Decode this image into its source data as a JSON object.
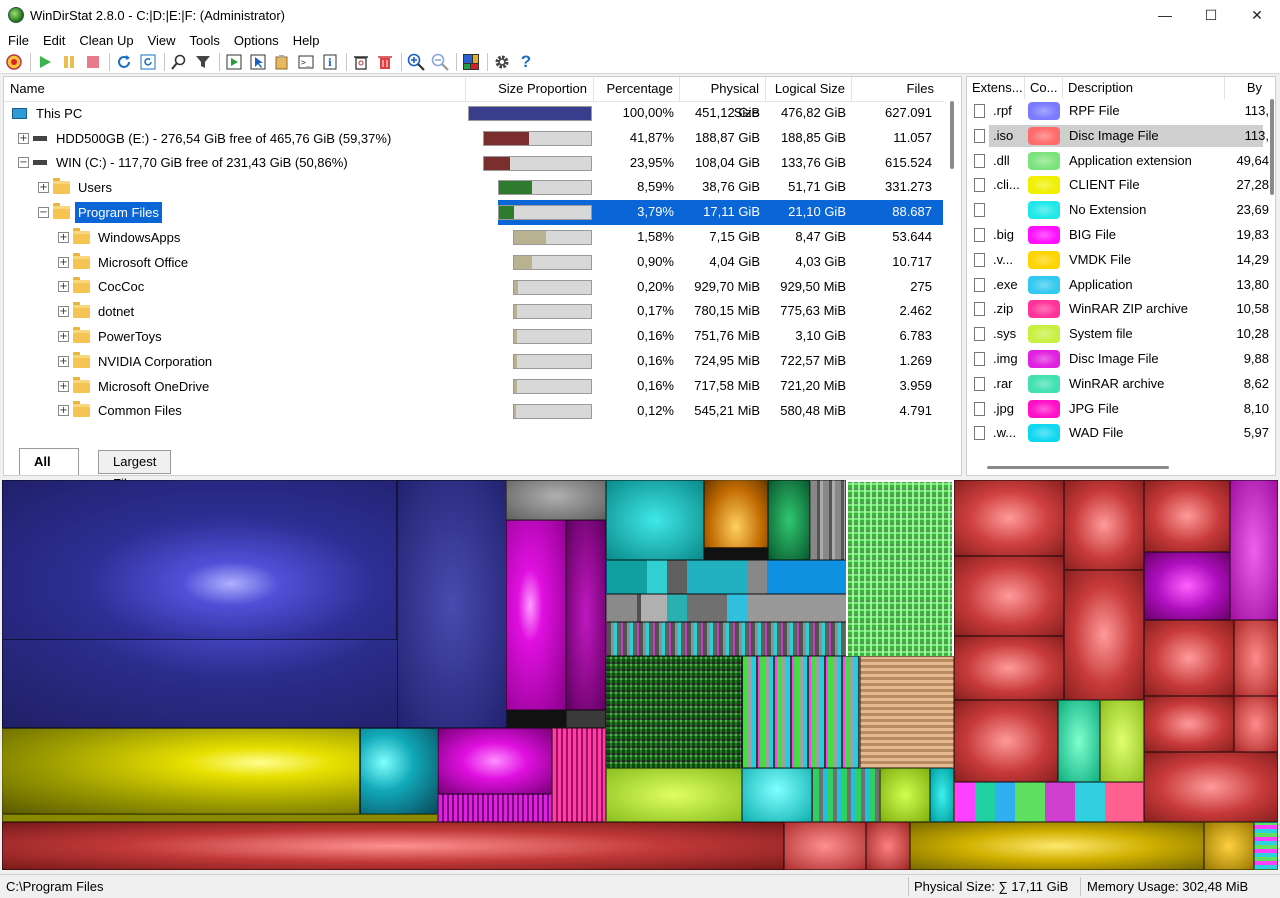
{
  "window": {
    "title": "WinDirStat 2.8.0 - C:|D:|E:|F:  (Administrator)",
    "min_glyph": "—",
    "max_glyph": "☐",
    "close_glyph": "✕"
  },
  "menu": [
    "File",
    "Edit",
    "Clean Up",
    "View",
    "Tools",
    "Options",
    "Help"
  ],
  "toolbar_icons": [
    "record-icon",
    "play-icon",
    "pause-icon",
    "stop-icon",
    "refresh-icon",
    "refresh-all-icon",
    "search-icon",
    "filter-icon",
    "open-item-icon",
    "select-in-explorer-icon",
    "copy-path-icon",
    "command-prompt-icon",
    "properties-icon",
    "recycle-icon",
    "delete-icon",
    "zoom-in-icon",
    "zoom-out-icon",
    "treemap-toggle-icon",
    "settings-icon",
    "help-icon"
  ],
  "tree": {
    "columns": {
      "name": "Name",
      "size_proportion": "Size Proportion",
      "percentage": "Percentage",
      "physical": "Physical Size",
      "logical": "Logical Size",
      "files": "Files"
    },
    "rows": [
      {
        "name": "This PC",
        "indent": 0,
        "icon": "pc",
        "expander": "",
        "bar_fill": 1.0,
        "bar_color": "#3a3d8c",
        "pct": "100,00%",
        "phys": "451,12 GiB",
        "log": "476,82 GiB",
        "files": "627.091"
      },
      {
        "name": "HDD500GB (E:) - 276,54 GiB free of 465,76 GiB (59,37%)",
        "indent": 1,
        "icon": "drive",
        "expander": "+",
        "bar_fill": 0.4187,
        "bar_color": "#7a2e2e",
        "pct": "41,87%",
        "phys": "188,87 GiB",
        "log": "188,85 GiB",
        "files": "11.057"
      },
      {
        "name": "WIN (C:) - 117,70 GiB free of 231,43 GiB (50,86%)",
        "indent": 1,
        "icon": "drive",
        "expander": "-",
        "bar_fill": 0.2395,
        "bar_color": "#7a2e2e",
        "pct": "23,95%",
        "phys": "108,04 GiB",
        "log": "133,76 GiB",
        "files": "615.524"
      },
      {
        "name": "Users",
        "indent": 2,
        "icon": "folder",
        "expander": "+",
        "bar_fill": 0.359,
        "bar_color": "#2e7a2e",
        "pct": "8,59%",
        "phys": "38,76 GiB",
        "log": "51,71 GiB",
        "files": "331.273"
      },
      {
        "name": "Program Files",
        "indent": 2,
        "icon": "folder",
        "expander": "-",
        "bar_fill": 0.158,
        "bar_color": "#2e7a2e",
        "pct": "3,79%",
        "phys": "17,11 GiB",
        "log": "21,10 GiB",
        "files": "88.687",
        "selected": true
      },
      {
        "name": "WindowsApps",
        "indent": 3,
        "icon": "folder",
        "expander": "+",
        "bar_fill": 0.417,
        "bar_color": "#b8b291",
        "pct": "1,58%",
        "phys": "7,15 GiB",
        "log": "8,47 GiB",
        "files": "53.644"
      },
      {
        "name": "Microsoft Office",
        "indent": 3,
        "icon": "folder",
        "expander": "+",
        "bar_fill": 0.237,
        "bar_color": "#b8b291",
        "pct": "0,90%",
        "phys": "4,04 GiB",
        "log": "4,03 GiB",
        "files": "10.717"
      },
      {
        "name": "CocCoc",
        "indent": 3,
        "icon": "folder",
        "expander": "+",
        "bar_fill": 0.053,
        "bar_color": "#b8b291",
        "pct": "0,20%",
        "phys": "929,70 MiB",
        "log": "929,50 MiB",
        "files": "275"
      },
      {
        "name": "dotnet",
        "indent": 3,
        "icon": "folder",
        "expander": "+",
        "bar_fill": 0.045,
        "bar_color": "#b8b291",
        "pct": "0,17%",
        "phys": "780,15 MiB",
        "log": "775,63 MiB",
        "files": "2.462"
      },
      {
        "name": "PowerToys",
        "indent": 3,
        "icon": "folder",
        "expander": "+",
        "bar_fill": 0.042,
        "bar_color": "#b8b291",
        "pct": "0,16%",
        "phys": "751,76 MiB",
        "log": "3,10 GiB",
        "files": "6.783"
      },
      {
        "name": "NVIDIA Corporation",
        "indent": 3,
        "icon": "folder",
        "expander": "+",
        "bar_fill": 0.042,
        "bar_color": "#b8b291",
        "pct": "0,16%",
        "phys": "724,95 MiB",
        "log": "722,57 MiB",
        "files": "1.269"
      },
      {
        "name": "Microsoft OneDrive",
        "indent": 3,
        "icon": "folder",
        "expander": "+",
        "bar_fill": 0.042,
        "bar_color": "#b8b291",
        "pct": "0,16%",
        "phys": "717,58 MiB",
        "log": "721,20 MiB",
        "files": "3.959"
      },
      {
        "name": "Common Files",
        "indent": 3,
        "icon": "folder",
        "expander": "+",
        "bar_fill": 0.032,
        "bar_color": "#b8b291",
        "pct": "0,12%",
        "phys": "545,21 MiB",
        "log": "580,48 MiB",
        "files": "4.791"
      }
    ],
    "tabs": {
      "all": "All Files",
      "largest": "Largest Files"
    }
  },
  "extensions": {
    "columns": {
      "ext": "Extens...",
      "color": "Co...",
      "desc": "Description",
      "bytes": "By"
    },
    "rows": [
      {
        "ext": ".rpf",
        "color": "#7b7bff",
        "desc": "RPF File",
        "bytes": "113,"
      },
      {
        "ext": ".iso",
        "color": "#ff6b6b",
        "desc": "Disc Image File",
        "bytes": "113,",
        "selected": true
      },
      {
        "ext": ".dll",
        "color": "#7de37d",
        "desc": "Application extension",
        "bytes": "49,64"
      },
      {
        "ext": ".cli...",
        "color": "#f0f000",
        "desc": "CLIENT File",
        "bytes": "27,28"
      },
      {
        "ext": "",
        "color": "#20e8e8",
        "desc": "No Extension",
        "bytes": "23,69"
      },
      {
        "ext": ".big",
        "color": "#ff10ff",
        "desc": "BIG File",
        "bytes": "19,83"
      },
      {
        "ext": ".v...",
        "color": "#ffd400",
        "desc": "VMDK File",
        "bytes": "14,29"
      },
      {
        "ext": ".exe",
        "color": "#33c9f0",
        "desc": "Application",
        "bytes": "13,80"
      },
      {
        "ext": ".zip",
        "color": "#ff3399",
        "desc": "WinRAR ZIP archive",
        "bytes": "10,58"
      },
      {
        "ext": ".sys",
        "color": "#c8f040",
        "desc": "System file",
        "bytes": "10,28"
      },
      {
        "ext": ".img",
        "color": "#e020e0",
        "desc": "Disc Image File",
        "bytes": "9,88"
      },
      {
        "ext": ".rar",
        "color": "#40e0b0",
        "desc": "WinRAR archive",
        "bytes": "8,62"
      },
      {
        "ext": ".jpg",
        "color": "#ff10c8",
        "desc": "JPG File",
        "bytes": "8,10"
      },
      {
        "ext": ".w...",
        "color": "#10d8f0",
        "desc": "WAD File",
        "bytes": "5,97"
      }
    ]
  },
  "status": {
    "path": "C:\\Program Files",
    "physical": "Physical Size: ∑ 17,11 GiB",
    "memory": "Memory Usage: 302,48 MiB"
  }
}
